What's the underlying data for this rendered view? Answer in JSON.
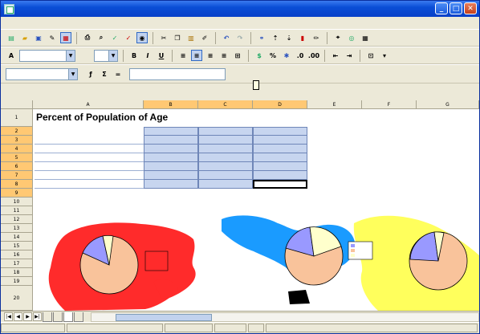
{
  "window": {
    "title": ""
  },
  "menu": [
    "",
    "",
    "",
    "",
    "",
    "",
    "",
    "",
    ""
  ],
  "font_name": "",
  "font_size": "",
  "name_box": "",
  "formula_value": "",
  "tooltip": "",
  "sheet": {
    "title": "Percent of Population of Age",
    "column_letters": [
      "A",
      "B",
      "C",
      "D",
      "E",
      "F",
      "G"
    ],
    "row_numbers": [
      "1",
      "2",
      "3",
      "4",
      "5",
      "6",
      "7",
      "8",
      "9",
      "10",
      "11",
      "12",
      "13",
      "14",
      "15",
      "16",
      "17",
      "18",
      "19",
      "20"
    ],
    "table": {
      "headers": [
        "",
        "",
        ""
      ],
      "rows": [
        {
          "region": "",
          "v": [
            "",
            "",
            ""
          ]
        },
        {
          "region": "",
          "v": [
            "",
            "",
            ""
          ]
        },
        {
          "region": "",
          "v": [
            "",
            "",
            ""
          ]
        },
        {
          "region": "",
          "v": [
            "",
            "",
            ""
          ]
        },
        {
          "region": "",
          "v": [
            "",
            "",
            ""
          ]
        },
        {
          "region": "",
          "v": [
            "",
            "",
            ""
          ]
        }
      ]
    }
  },
  "tabs": [
    "",
    "",
    "",
    ""
  ],
  "status": {
    "sheet": "",
    "style": "",
    "zoom": "",
    "mode": "",
    "sum": ""
  },
  "colors": {
    "map_red": "#ff2b2b",
    "map_blue": "#1a9bff",
    "map_yellow": "#ffff5c",
    "pie_salmon": "#f9c39b",
    "pie_purple": "#9999ff",
    "pie_cream": "#ffffcc"
  }
}
